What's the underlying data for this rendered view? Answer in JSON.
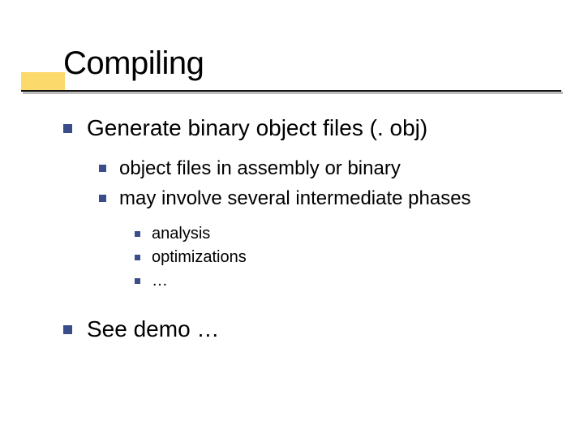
{
  "title": "Compiling",
  "bullets": {
    "l1a": "Generate binary object files (. obj)",
    "l2a": "object files in assembly or binary",
    "l2b": "may involve several intermediate phases",
    "l3a": "analysis",
    "l3b": "optimizations",
    "l3c": "…",
    "l1b": "See demo …"
  },
  "colors": {
    "accent": "#fbd96a",
    "bullet": "#3b4d89"
  }
}
